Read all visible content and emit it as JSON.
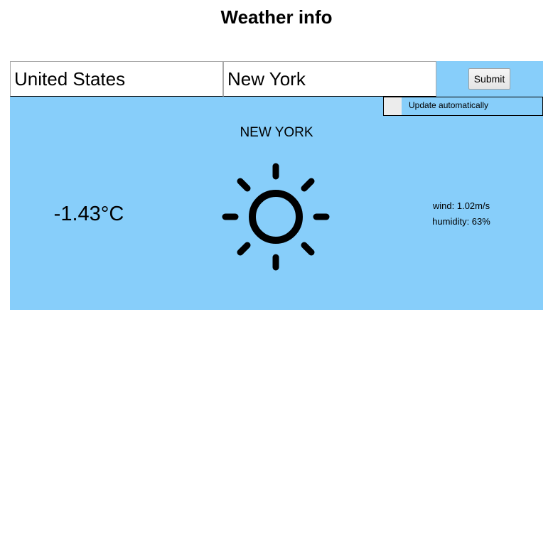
{
  "page": {
    "title": "Weather info"
  },
  "form": {
    "country_value": "United States",
    "city_value": "New York",
    "submit_label": "Submit"
  },
  "auto_update": {
    "label": "Update automatically",
    "checked": false
  },
  "weather": {
    "city": "NEW YORK",
    "temperature": "-1.43°C",
    "wind": "wind: 1.02m/s",
    "humidity": "humidity: 63%",
    "icon": "sun-icon"
  },
  "colors": {
    "panel_background": "#87cefa",
    "toggle_background": "#ececec"
  }
}
